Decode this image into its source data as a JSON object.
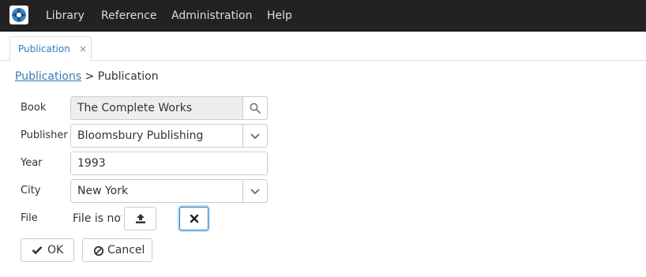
{
  "nav": {
    "items": [
      {
        "label": "Library"
      },
      {
        "label": "Reference"
      },
      {
        "label": "Administration"
      },
      {
        "label": "Help"
      }
    ]
  },
  "tabs": [
    {
      "label": "Publication",
      "close": "×"
    }
  ],
  "breadcrumb": {
    "parent": "Publications",
    "separator": ">",
    "current": "Publication"
  },
  "form": {
    "book": {
      "label": "Book",
      "value": "The Complete Works",
      "icon": "search-icon"
    },
    "publisher": {
      "label": "Publisher",
      "value": "Bloomsbury Publishing",
      "icon": "chevron-down-icon"
    },
    "year": {
      "label": "Year",
      "value": "1993"
    },
    "city": {
      "label": "City",
      "value": "New York",
      "icon": "chevron-down-icon"
    },
    "file": {
      "label": "File",
      "status": "File is not",
      "upload_icon": "upload-icon",
      "clear_icon": "close-icon"
    }
  },
  "actions": {
    "ok_label": "OK",
    "cancel_label": "Cancel"
  },
  "colors": {
    "navbar": "#222222",
    "link": "#337ab7",
    "border": "#cccccc",
    "readonly_bg": "#eeeeee"
  }
}
